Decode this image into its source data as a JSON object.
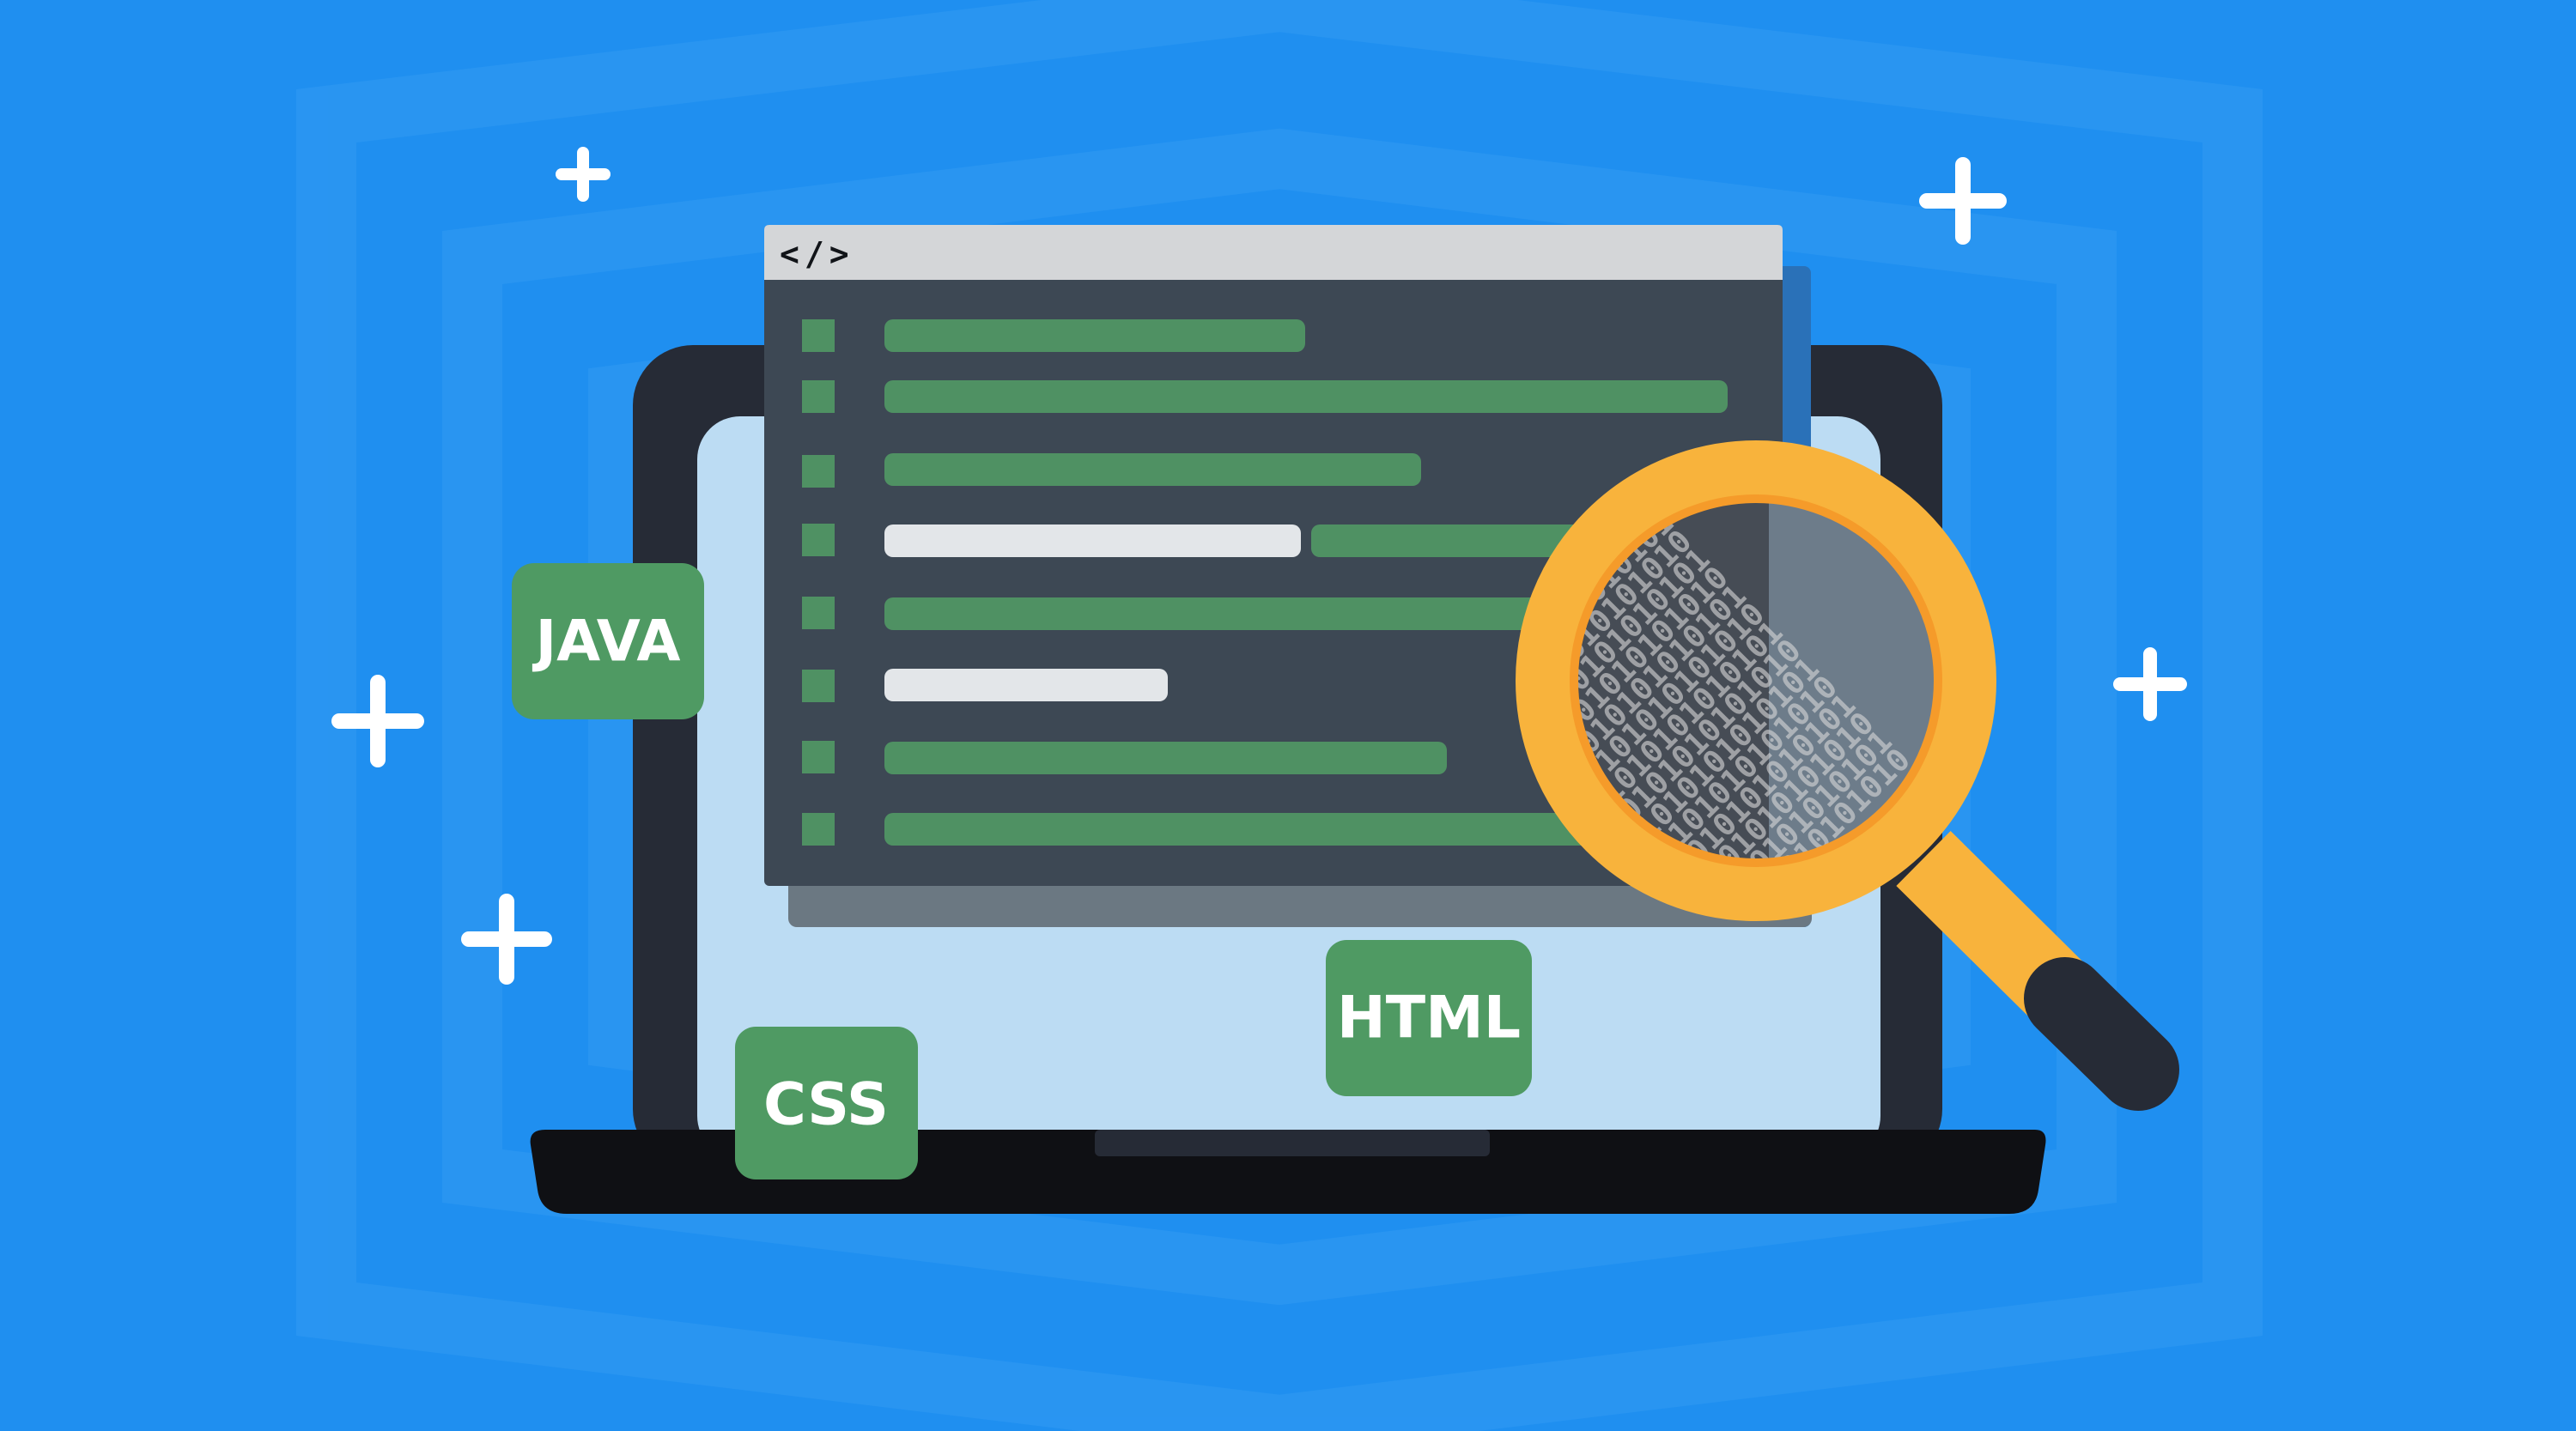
{
  "code_window": {
    "title": "</>"
  },
  "tags": {
    "java": "JAVA",
    "css": "CSS",
    "html": "HTML"
  },
  "binary_rows": [
    "0101010101010101",
    "1010101010101010",
    "0101010101010101",
    "1010101010101010",
    "0101010101010101",
    "1010101010101010",
    "0101010101010101",
    "1010101010101010",
    "0101010101010101",
    "1010101010101010",
    "0101010101010101",
    "1010101010101010",
    "0101010101010101",
    "1010101010101010"
  ],
  "colors": {
    "background": "#1f8ff0",
    "hexagon_ring": "#2b97f2",
    "laptop_frame": "#262b36",
    "laptop_screen": "#bcdcf3",
    "laptop_base": "#0f1014",
    "window_body": "#3d4854",
    "window_titlebar": "#d4d6d8",
    "window_shadow": "#6b7882",
    "code_green": "#4f9163",
    "code_white": "#e3e6e9",
    "tag_green": "#4f9a63",
    "magnifier_ring": "#f8b33c",
    "magnifier_handle_tip": "#262b36",
    "sparkle": "#ffffff"
  }
}
